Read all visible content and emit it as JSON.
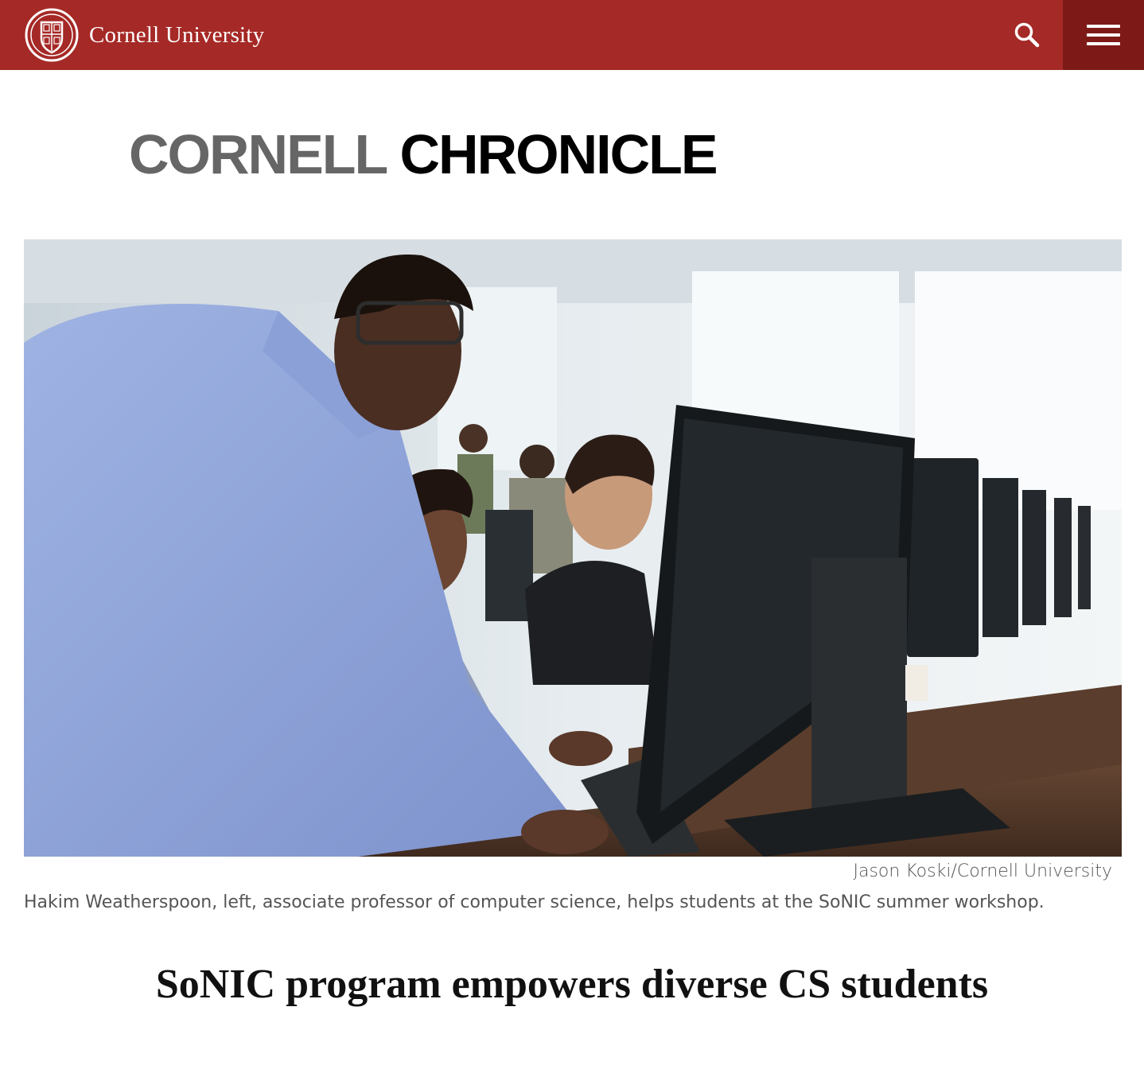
{
  "header": {
    "university_name": "Cornell University",
    "brand_color": "#a52926",
    "menu_color": "#7d1a17",
    "search_icon": "search-icon",
    "menu_icon": "hamburger-menu-icon"
  },
  "masthead": {
    "word1": "CORNELL",
    "word2": "CHRONICLE"
  },
  "hero": {
    "credit": "Jason Koski/Cornell University",
    "caption": "Hakim Weatherspoon, left, associate professor of computer science, helps students at the SoNIC summer workshop."
  },
  "article": {
    "headline": "SoNIC program empowers diverse CS students"
  }
}
